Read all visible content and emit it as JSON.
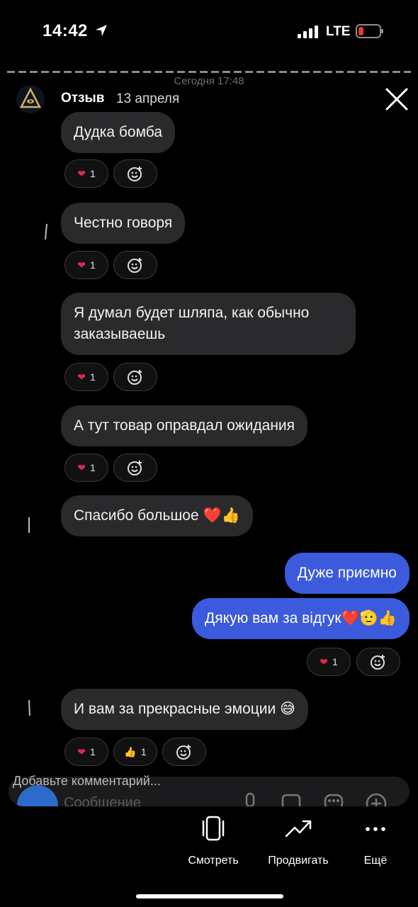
{
  "status": {
    "time": "14:42",
    "network": "LTE",
    "battery_color": "#e5383b"
  },
  "story": {
    "separator_label": "Сегодня 17:48",
    "author": "Отзыв",
    "date": "13 апреля"
  },
  "messages": [
    {
      "text": "Дудка бомба",
      "dir": "in"
    },
    {
      "text": "Честно говоря",
      "dir": "in"
    },
    {
      "text": "Я думал будет шляпа, как обычно\nзаказываешь",
      "dir": "in"
    },
    {
      "text": "А тут товар оправдал ожидания",
      "dir": "in"
    },
    {
      "text": "Спасибо большое ❤️👍",
      "dir": "in"
    },
    {
      "text": "Дуже приємно",
      "dir": "out"
    },
    {
      "text": "Дякую вам за відгук❤️🫡👍",
      "dir": "out"
    },
    {
      "text": "И вам за прекрасные эмоции 😅",
      "dir": "in"
    }
  ],
  "reactions": {
    "heart_count": "1",
    "thumb_count": "1"
  },
  "composer": {
    "comment_hint": "Добавьте комментарий...",
    "placeholder": "Сообщение"
  },
  "actions": {
    "watch": "Смотреть",
    "promote": "Продвигать",
    "more": "Ещё"
  },
  "colors": {
    "outgoing_bubble": "#3b5bdc",
    "incoming_bubble": "#2a2a2c",
    "heart": "#e0284f"
  }
}
